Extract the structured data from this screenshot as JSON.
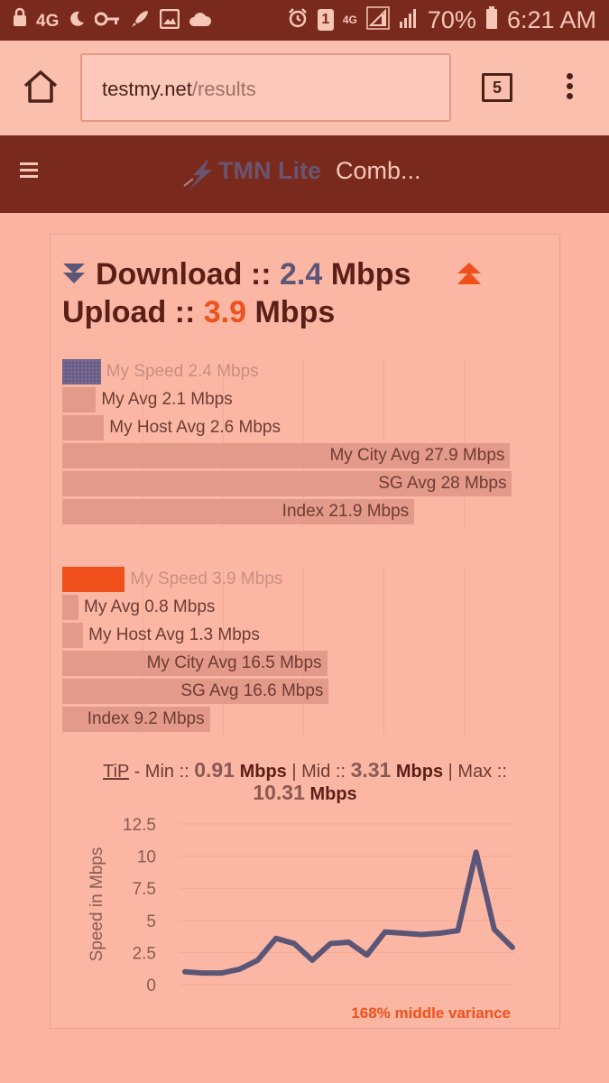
{
  "status_bar": {
    "left_icons": [
      "lock-icon",
      "moon-icon",
      "key-icon",
      "rocket-icon",
      "image-icon",
      "cloud-icon"
    ],
    "network_left": "4G",
    "sim_badge": "1",
    "network_right": "4G",
    "battery": "70%",
    "time": "6:21 AM"
  },
  "browser": {
    "url_host": "testmy.net",
    "url_path": "/results",
    "tab_count": "5"
  },
  "site_header": {
    "logo_text": "TMN Lite",
    "subtitle": "Comb..."
  },
  "results": {
    "download_label": "Download ::",
    "download_value": "2.4",
    "download_unit": "Mbps",
    "upload_label": "Upload ::",
    "upload_value": "3.9",
    "upload_unit": "Mbps",
    "download_color": "#5b5677",
    "upload_color": "#f0501c"
  },
  "download_bars": [
    {
      "label": "My Speed 2.4 Mbps",
      "value": 2.4,
      "highlight": true
    },
    {
      "label": "My Avg 2.1 Mbps",
      "value": 2.1,
      "highlight": false
    },
    {
      "label": "My Host Avg 2.6 Mbps",
      "value": 2.6,
      "highlight": false
    },
    {
      "label": "My City Avg 27.9 Mbps",
      "value": 27.9,
      "highlight": false
    },
    {
      "label": "SG Avg 28 Mbps",
      "value": 28,
      "highlight": false
    },
    {
      "label": "Index 21.9 Mbps",
      "value": 21.9,
      "highlight": false
    }
  ],
  "upload_bars": [
    {
      "label": "My Speed 3.9 Mbps",
      "value": 3.9,
      "highlight": true
    },
    {
      "label": "My Avg 0.8 Mbps",
      "value": 0.8,
      "highlight": false
    },
    {
      "label": "My Host Avg 1.3 Mbps",
      "value": 1.3,
      "highlight": false
    },
    {
      "label": "My City Avg 16.5 Mbps",
      "value": 16.5,
      "highlight": false
    },
    {
      "label": "SG Avg 16.6 Mbps",
      "value": 16.6,
      "highlight": false
    },
    {
      "label": "Index 9.2 Mbps",
      "value": 9.2,
      "highlight": false
    }
  ],
  "tip": {
    "link": "TiP",
    "min_label": " - Min :: ",
    "min_value": "0.91",
    "mid_label": " | Mid :: ",
    "mid_value": "3.31",
    "max_label": " | Max :: ",
    "max_value": "10.31",
    "unit": " Mbps"
  },
  "chart_data": {
    "type": "line",
    "x": [
      1,
      2,
      3,
      4,
      5,
      6,
      7,
      8,
      9,
      10,
      11,
      12,
      13,
      14,
      15,
      16,
      17,
      18,
      19
    ],
    "series": [
      {
        "values": [
          1.0,
          0.9,
          0.9,
          1.2,
          1.9,
          3.6,
          3.2,
          1.9,
          3.2,
          3.3,
          2.3,
          4.1,
          4.0,
          3.9,
          4.0,
          4.2,
          10.3,
          4.3,
          2.9
        ]
      }
    ],
    "ylabel": "Speed in Mbps",
    "xlabel": "",
    "ylim": [
      0,
      12.5
    ],
    "yticks": [
      "0",
      "2.5",
      "5",
      "7.5",
      "10",
      "12.5"
    ],
    "grid": true,
    "line_color": "#5b5677",
    "annotation": "168% middle variance",
    "annotation_color": "#f0501c"
  }
}
